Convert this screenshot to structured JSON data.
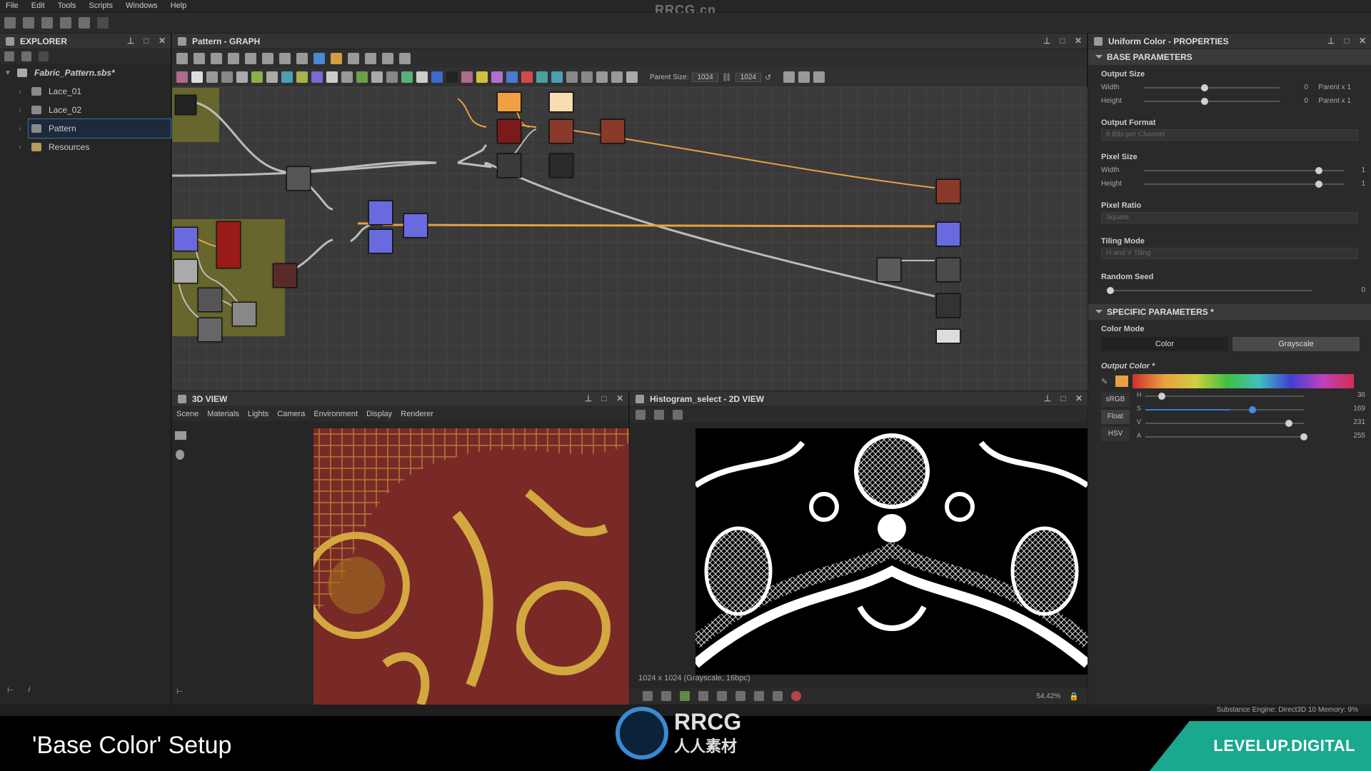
{
  "menu": [
    "File",
    "Edit",
    "Tools",
    "Scripts",
    "Windows",
    "Help"
  ],
  "watermark_title": "RRCG.cn",
  "explorer": {
    "title": "EXPLORER",
    "file": "Fabric_Pattern.sbs*",
    "items": [
      "Lace_01",
      "Lace_02",
      "Pattern",
      "Resources"
    ],
    "selected": "Pattern"
  },
  "graph": {
    "title": "Pattern - GRAPH",
    "parent_size_label": "Parent Size:",
    "size_w": "1024",
    "size_h": "1024"
  },
  "properties": {
    "title": "Uniform Color - PROPERTIES",
    "base_section": "BASE PARAMETERS",
    "output_size": {
      "label": "Output Size",
      "width_label": "Width",
      "height_label": "Height",
      "width_val": "0",
      "height_val": "0",
      "width_rel": "Parent x 1",
      "height_rel": "Parent x 1"
    },
    "output_format": {
      "label": "Output Format",
      "value": "8 Bits per Channel"
    },
    "pixel_size": {
      "label": "Pixel Size",
      "width_label": "Width",
      "height_label": "Height",
      "width_val": "1",
      "height_val": "1"
    },
    "pixel_ratio": {
      "label": "Pixel Ratio",
      "value": "Square"
    },
    "tiling_mode": {
      "label": "Tiling Mode",
      "value": "H and V Tiling"
    },
    "random_seed": {
      "label": "Random Seed",
      "value": "0"
    },
    "specific_section": "SPECIFIC PARAMETERS *",
    "color_mode": {
      "label": "Color Mode",
      "opt1": "Color",
      "opt2": "Grayscale"
    },
    "output_color": {
      "label": "Output Color *",
      "swatch": "#e8a040",
      "modes": [
        "sRGB",
        "Float",
        "HSV"
      ],
      "channels": [
        {
          "name": "H",
          "value": "36"
        },
        {
          "name": "S",
          "value": "169"
        },
        {
          "name": "V",
          "value": "231"
        },
        {
          "name": "A",
          "value": "255"
        }
      ]
    }
  },
  "view3d": {
    "title": "3D VIEW",
    "menu": [
      "Scene",
      "Materials",
      "Lights",
      "Camera",
      "Environment",
      "Display",
      "Renderer"
    ]
  },
  "view2d": {
    "title": "Histogram_select - 2D VIEW",
    "info": "1024 x 1024 (Grayscale, 16bpc)",
    "zoom": "54.42%"
  },
  "status": {
    "engine": "Substance Engine: Direct3D 10  Memory: 9%"
  },
  "caption": "'Base Color' Setup",
  "logo_main": "RRCG",
  "logo_sub": "人人素材",
  "brand": "LEVELUP.DIGITAL",
  "colors": {
    "accent": "#e8a040",
    "selection": "#3a6ea8",
    "brand": "#1aa88e"
  }
}
